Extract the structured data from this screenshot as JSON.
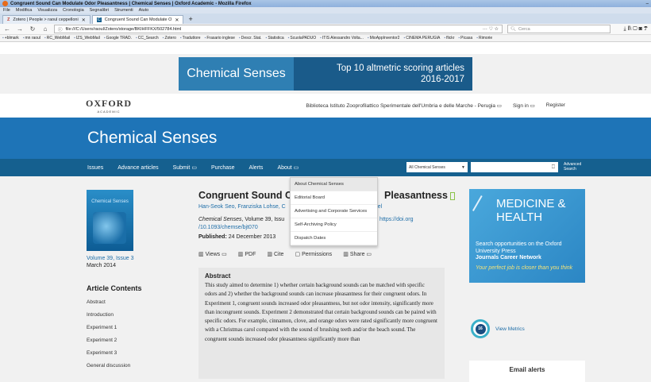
{
  "browser": {
    "window_title": "Congruent Sound Can Modulate Odor Pleasantness | Chemical Senses | Oxford Academic - Mozilla Firefox",
    "window_controls": "–",
    "menu": [
      "File",
      "Modifica",
      "Visualizza",
      "Cronologia",
      "Segnalibri",
      "Strumenti",
      "Aiuto"
    ],
    "tabs": [
      {
        "label": "Zotero | People > raoul ceppelloni",
        "icon": "Z"
      },
      {
        "label": "Congruent Sound Can Modulate O",
        "icon": "C"
      }
    ],
    "url": "file:///C:/Users/raoul/Zotero/storage/BKIHFFKX/502784.html",
    "url_icon": "ⓘ",
    "url_actions": "··· ♡ ☆",
    "search_placeholder": "Cerca",
    "toolbar_icons": "⤓ ‖\\ ▢ ◙ ☂",
    "bookmarks": [
      "+blmark",
      "mn raoul",
      "RC_WebMail",
      "IZS_WebMail",
      "Google TRAD.",
      "CC_Search",
      "Zotero",
      "Traduttore",
      "Frasario inglese",
      "Descr. Stat.",
      "Statistica",
      "ScuolaPADUO",
      "ITIS Alessandro Volta...",
      "MioAppInventor2",
      "CINEMA PERUGIA",
      "flickr",
      "Picasa",
      "Rimorie"
    ]
  },
  "ad": {
    "left": "Chemical Senses",
    "right_line1": "Top 10 altmetric scoring articles",
    "right_line2": "2016-2017"
  },
  "oxford": {
    "logo": "OXFORD",
    "logo_sub": "ACADEMIC",
    "institution": "Biblioteca Istituto Zooprofilattico Sperimentale dell'Umbria e delle Marche - Perugia ▭",
    "sign_in": "Sign in ▭",
    "register": "Register"
  },
  "hero": {
    "title": "Chemical Senses"
  },
  "nav": {
    "items": [
      "Issues",
      "Advance articles",
      "Submit ▭",
      "Purchase",
      "Alerts",
      "About ▭"
    ],
    "select_value": "All Chemical Senses",
    "select_arrow": "▼",
    "search_icon": "⎕",
    "advanced_search": "Advanced Search"
  },
  "dropdown": [
    "About Chemical Senses",
    "Editorial Board",
    "Advertising and Corporate Services",
    "Self-Archiving Policy",
    "Dispatch Dates"
  ],
  "left": {
    "cover_title": "Chemical Senses",
    "volume": "Volume 39, Issue 3",
    "date": "March 2014",
    "contents_title": "Article Contents",
    "contents": [
      "Abstract",
      "Introduction",
      "Experiment 1",
      "Experiment 2",
      "Experiment 3",
      "General discussion"
    ]
  },
  "article": {
    "title": "Congruent Sound C",
    "title_end": "Pleasantness",
    "authors": "Han-Seok Seo, Franziska Lohse, C",
    "authors_end": "el",
    "cite_journal": "Chemical Senses",
    "cite_rest": ", Volume 39, Issu",
    "cite_doi_part": ", https://doi.org",
    "cite_doi2": "/10.1093/chemse/bjt070",
    "published_label": "Published:",
    "published_date": "24 December 2013",
    "tools": [
      {
        "icon": "▥",
        "label": "Views ▭"
      },
      {
        "icon": "▥",
        "label": "PDF"
      },
      {
        "icon": "▥",
        "label": "Cite"
      },
      {
        "icon": "▢",
        "label": "Permissions"
      },
      {
        "icon": "▥",
        "label": "Share ▭"
      }
    ],
    "abstract_title": "Abstract",
    "abstract_text": "This study aimed to determine 1) whether certain background sounds can be matched with specific odors and 2) whether the background sounds can increase pleasantness for their congruent odors. In Experiment 1, congruent sounds increased odor pleasantness, but not odor intensity, significantly more than incongruent sounds. Experiment 2 demonstrated that certain background sounds can be paired with specific odors. For example, cinnamon, clove, and orange odors were rated significantly more congruent with a Christmas carol compared with the sound of brushing teeth and/or the beach sound. The congruent sounds increased odor pleasantness significantly more than"
  },
  "right": {
    "ad_line1": "MEDICINE &",
    "ad_line2": "HEALTH",
    "ad_text1": "Search opportunities on the Oxford University Press",
    "ad_text2": "Journals Career Network",
    "ad_text3": "Your perfect job is closer than you think",
    "metric_score": "16",
    "view_metrics": "View Metrics",
    "email_alerts": "Email alerts"
  }
}
